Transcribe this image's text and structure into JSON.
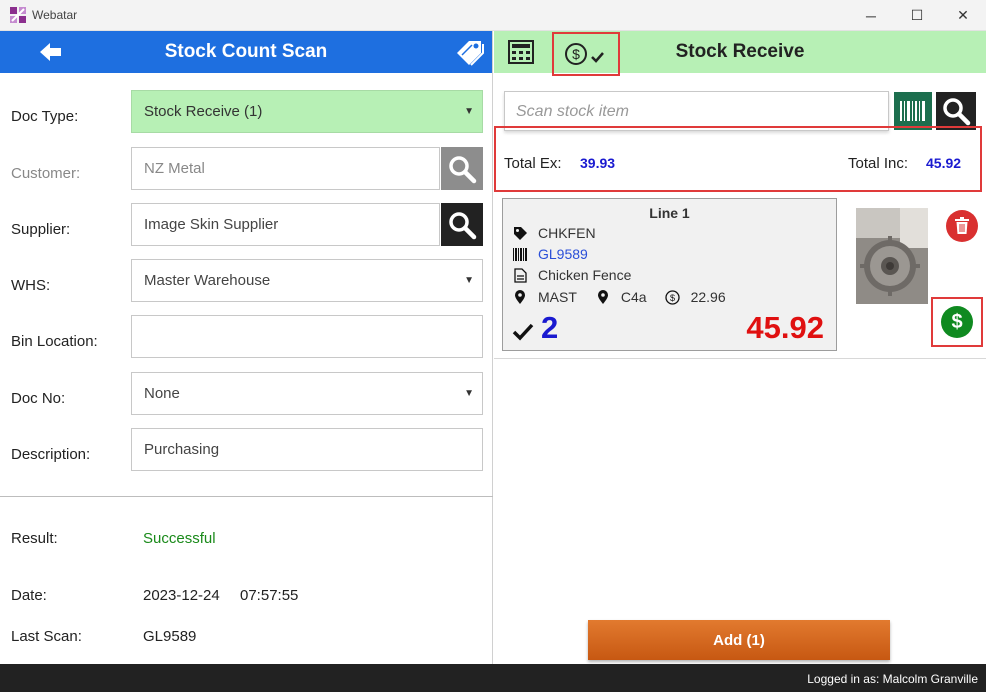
{
  "window": {
    "title": "Webatar",
    "minimize": "─",
    "maximize": "☐",
    "close": "✕"
  },
  "left": {
    "header_title": "Stock Count Scan",
    "fields": {
      "doc_type": {
        "label": "Doc Type:",
        "value": "Stock Receive (1)"
      },
      "customer": {
        "label": "Customer:",
        "value": "NZ Metal"
      },
      "supplier": {
        "label": "Supplier:",
        "value": "Image Skin Supplier"
      },
      "whs": {
        "label": "WHS:",
        "value": "Master Warehouse"
      },
      "bin_location": {
        "label": "Bin Location:",
        "value": ""
      },
      "doc_no": {
        "label": "Doc No:",
        "value": "None"
      },
      "description": {
        "label": "Description:",
        "value": "Purchasing"
      }
    },
    "result": {
      "label": "Result:",
      "value": "Successful"
    },
    "date": {
      "label": "Date:",
      "date": "2023-12-24",
      "time": "07:57:55"
    },
    "last_scan": {
      "label": "Last Scan:",
      "value": "GL9589"
    }
  },
  "right": {
    "header_title": "Stock Receive",
    "scan": {
      "placeholder": "Scan stock item"
    },
    "totals": {
      "ex_label": "Total Ex:",
      "ex_value": "39.93",
      "inc_label": "Total Inc:",
      "inc_value": "45.92"
    },
    "line": {
      "title": "Line  1",
      "code": "CHKFEN",
      "barcode": "GL9589",
      "description": "Chicken Fence",
      "warehouse": "MAST",
      "bin": "C4a",
      "price": "22.96",
      "qty": "2",
      "amount": "45.92"
    },
    "add_button": "Add (1)"
  },
  "status": {
    "logged_in": "Logged in as: Malcolm Granville"
  },
  "colors": {
    "left_header": "#1e6fe0",
    "right_header": "#b7f0b5",
    "highlight_border": "#e03a3a",
    "total_value": "#1a1ad0",
    "amount": "#e01010",
    "success": "#1a8a1a",
    "add_button": "#d86a20"
  }
}
